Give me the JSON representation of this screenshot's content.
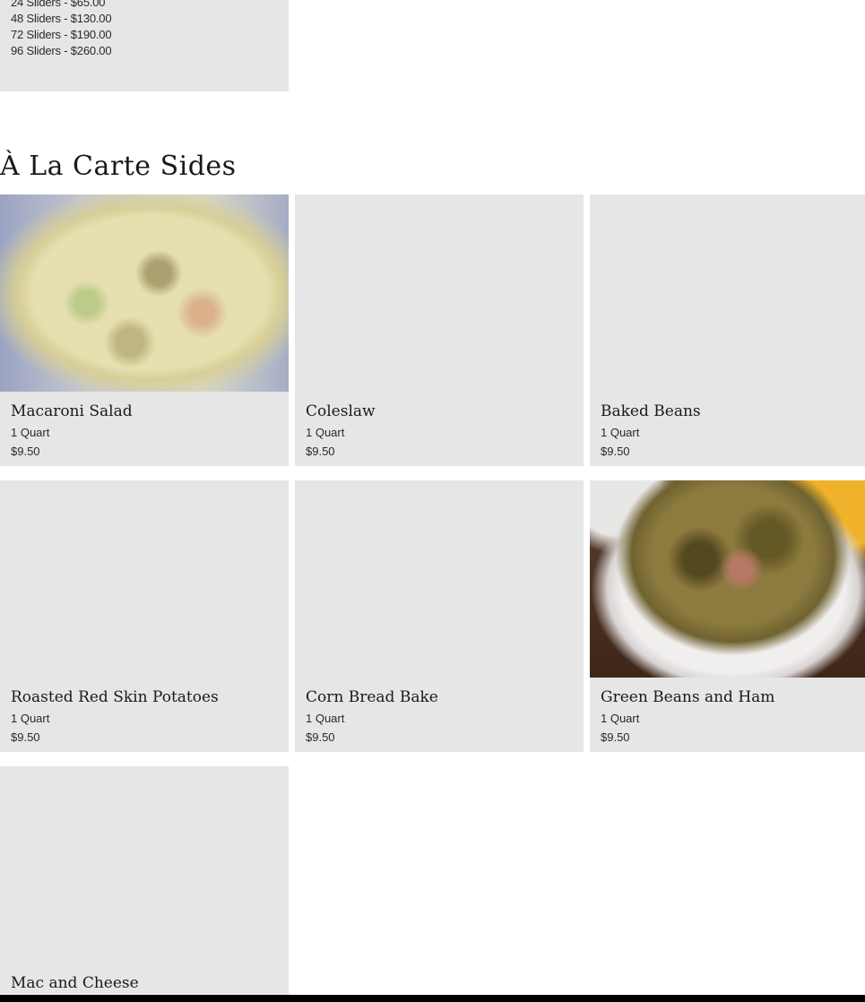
{
  "previous_card": {
    "lines": [
      "24 Sliders - $65.00",
      "48 Sliders - $130.00",
      "72 Sliders - $190.00",
      "96 Sliders - $260.00"
    ]
  },
  "section": {
    "title": "À La Carte Sides",
    "items": [
      {
        "name": "Macaroni Salad",
        "description": "1 Quart",
        "price": "$9.50",
        "image": "macaroni-salad-photo"
      },
      {
        "name": "Coleslaw",
        "description": "1 Quart",
        "price": "$9.50",
        "image": ""
      },
      {
        "name": "Baked Beans",
        "description": "1 Quart",
        "price": "$9.50",
        "image": ""
      },
      {
        "name": "Roasted Red Skin Potatoes",
        "description": "1 Quart",
        "price": "$9.50",
        "image": ""
      },
      {
        "name": "Corn Bread Bake",
        "description": "1 Quart",
        "price": "$9.50",
        "image": ""
      },
      {
        "name": "Green Beans and Ham",
        "description": "1 Quart",
        "price": "$9.50",
        "image": "green-beans-ham-photo"
      },
      {
        "name": "Mac and Cheese",
        "description": "",
        "price": "",
        "image": ""
      }
    ]
  },
  "colors": {
    "card_background": "#e7e6e7",
    "page_background": "#ffffff",
    "footer_bar": "#000000"
  }
}
